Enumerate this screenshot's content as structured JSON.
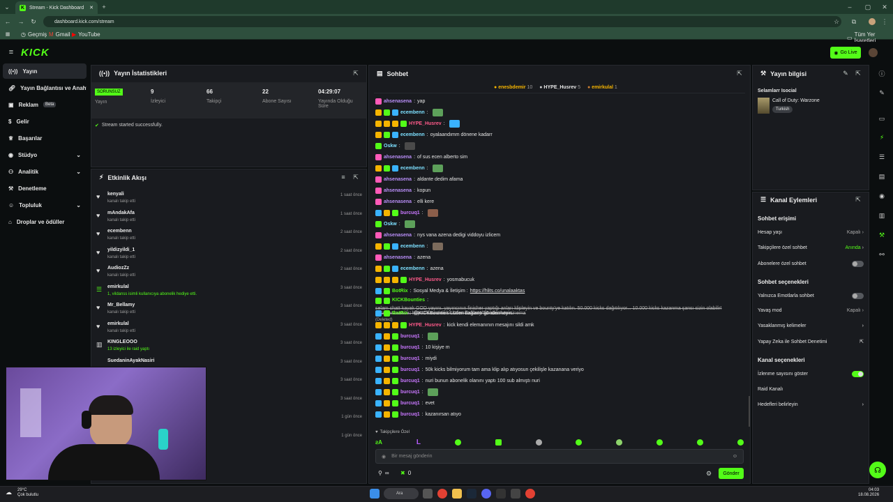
{
  "browser": {
    "tab_title": "Stream - Kick Dashboard",
    "url": "dashboard.kick.com/stream",
    "bookmarks": [
      "Geçmiş",
      "Gmail",
      "YouTube"
    ],
    "all_bookmarks": "Tüm Yer İşaretleri"
  },
  "header": {
    "logo": "KICK",
    "go_live": "Go Live"
  },
  "sidebar": {
    "items": [
      {
        "label": "Yayın"
      },
      {
        "label": "Yayın Bağlantısı ve Anahtarı"
      },
      {
        "label": "Reklam",
        "badge": "Beta"
      },
      {
        "label": "Gelir"
      },
      {
        "label": "Başarılar"
      },
      {
        "label": "Stüdyo"
      },
      {
        "label": "Analitik"
      },
      {
        "label": "Denetleme"
      },
      {
        "label": "Topluluk"
      },
      {
        "label": "Droplar ve ödüller"
      }
    ]
  },
  "stats": {
    "title": "Yayın İstatistikleri",
    "status_badge": "SORUNSUZ",
    "status_label": "Yayın",
    "viewers": "9",
    "viewers_label": "İzleyici",
    "followers": "66",
    "followers_label": "Takipçi",
    "subs": "22",
    "subs_label": "Abone Sayısı",
    "uptime": "04:29:07",
    "uptime_label": "Yayında Olduğu Süre",
    "success": "Stream started successfully."
  },
  "activity": {
    "title": "Etkinlik Akışı",
    "items": [
      {
        "name": "kenyali",
        "desc": "kanalı takip etti",
        "time": "1 saat önce"
      },
      {
        "name": "mAndakAfa",
        "desc": "kanalı takip etti",
        "time": "1 saat önce"
      },
      {
        "name": "ecembenn",
        "desc": "kanalı takip etti",
        "time": "2 saat önce"
      },
      {
        "name": "yildizyildi_1",
        "desc": "kanalı takip etti",
        "time": "2 saat önce"
      },
      {
        "name": "AudiozZz",
        "desc": "kanalı takip etti",
        "time": "2 saat önce"
      },
      {
        "name": "emirkulal",
        "desc": "1, vildanss isimli kullanıcıya abonelik hediye etti.",
        "time": "3 saat önce"
      },
      {
        "name": "Mr_Bellamy",
        "desc": "kanalı takip etti",
        "time": "3 saat önce"
      },
      {
        "name": "emirkulal",
        "desc": "kanalı takip etti",
        "time": "3 saat önce"
      },
      {
        "name": "KINGLEOOO",
        "desc": "13 izleyici ile raid yaptı",
        "time": "3 saat önce"
      },
      {
        "name": "SuedaninAyakNasiri",
        "desc": "",
        "time": "3 saat önce"
      },
      {
        "name": "",
        "desc": "",
        "time": "3 saat önce"
      },
      {
        "name": "",
        "desc": "",
        "time": "3 saat önce"
      },
      {
        "name": "",
        "desc": "",
        "time": "1 gün önce"
      },
      {
        "name": "",
        "desc": "",
        "time": "1 gün önce"
      }
    ]
  },
  "chat": {
    "title": "Sohbet",
    "leaders": [
      {
        "name": "enesbdemir",
        "count": "10"
      },
      {
        "name": "HYPE_Husrev",
        "count": "5"
      },
      {
        "name": "emirkulal",
        "count": "1"
      }
    ],
    "messages": [
      {
        "user": "ahsenasena",
        "color": "#b98ef8",
        "text": "yap"
      },
      {
        "user": "ecembenn",
        "color": "#7ee0ff",
        "text": ""
      },
      {
        "user": "HYPE_Husrev",
        "color": "#ff5a8a",
        "text": ""
      },
      {
        "user": "ecembenn",
        "color": "#7ee0ff",
        "text": "oyalaandımm dönene kadarr"
      },
      {
        "user": "Oskw",
        "color": "#7ee0ff",
        "text": ""
      },
      {
        "user": "ahsenasena",
        "color": "#b98ef8",
        "text": "of sus ecen alberto sim"
      },
      {
        "user": "ecembenn",
        "color": "#7ee0ff",
        "text": ""
      },
      {
        "user": "ahsenasena",
        "color": "#b98ef8",
        "text": "aldante dedim afama"
      },
      {
        "user": "ahsenasena",
        "color": "#b98ef8",
        "text": "kopun"
      },
      {
        "user": "ahsenasena",
        "color": "#b98ef8",
        "text": "elli kere"
      },
      {
        "user": "burcuq1",
        "color": "#c977ff",
        "text": ""
      },
      {
        "user": "Oskw",
        "color": "#7ee0ff",
        "text": ""
      },
      {
        "user": "ahsenasena",
        "color": "#b98ef8",
        "text": "nys vana azena dedigi viddoyu izlicem"
      },
      {
        "user": "ecembenn",
        "color": "#7ee0ff",
        "text": ""
      },
      {
        "user": "ahsenasena",
        "color": "#b98ef8",
        "text": "azena"
      },
      {
        "user": "ecembenn",
        "color": "#7ee0ff",
        "text": "azena"
      },
      {
        "user": "HYPE_Husrev",
        "color": "#ff5a8a",
        "text": "yosmabucuk"
      },
      {
        "user": "BotRix",
        "color": "#53fc18",
        "text": "Sosyal Medya & İletişim : ",
        "link": "https://hlits.co/unalaaktas"
      },
      {
        "user": "KICKBounties",
        "color": "#53fc18",
        "text": "selam chatt kayak GOD yayını. yayıncının finisher yaptığı anları klipleyin ve bounty'ye katılın. 50.000 kicks dağıtılıyor... 10.000 kicks kazanma şansı sizin olabilir! detaylar burada: https://bounties.kick.com/bounty/58-absolute-cinema",
        "deleted": "(Deleted)"
      },
      {
        "user": "BotRix",
        "color": "#53fc18",
        "text": "@KICKBounties Lütfen bağlantı göndermeyin."
      },
      {
        "user": "HYPE_Husrev",
        "color": "#ff5a8a",
        "text": "kick kendi elemanının mesajını sildi amk"
      },
      {
        "user": "burcuq1",
        "color": "#c977ff",
        "text": ""
      },
      {
        "user": "burcuq1",
        "color": "#c977ff",
        "text": "10 kişiye m"
      },
      {
        "user": "burcuq1",
        "color": "#c977ff",
        "text": "miydi"
      },
      {
        "user": "burcuq1",
        "color": "#c977ff",
        "text": "50k kicks bilmiyorum tam ama klip alıp atıyosun çekilişle kazanana veriyo"
      },
      {
        "user": "burcuq1",
        "color": "#c977ff",
        "text": "nuri bunun abonelik olanını yaptı 100 sub almıştı nuri"
      },
      {
        "user": "burcuq1",
        "color": "#c977ff",
        "text": ""
      },
      {
        "user": "burcuq1",
        "color": "#c977ff",
        "text": "evet"
      },
      {
        "user": "burcuq1",
        "color": "#c977ff",
        "text": "kazanırsan atıyo"
      }
    ],
    "followers_only": "Takipçilere Özel",
    "input_placeholder": "Bir mesaj gönderin",
    "infinity": "∞",
    "count": "0",
    "send": "Gönder"
  },
  "stream_info": {
    "title": "Yayın bilgisi",
    "stream_title": "Selamlarr Isocial",
    "category": "Call of Duty: Warzone",
    "language": "Turkish"
  },
  "channel_actions": {
    "title": "Kanal Eylemleri",
    "chat_access": "Sohbet erişimi",
    "account_age": "Hesap yaşı",
    "account_age_val": "Kapalı",
    "followers_chat": "Takipçilere özel sohbet",
    "followers_chat_val": "Anında",
    "subs_chat": "Abonelere özel sohbet",
    "chat_options": "Sohbet seçenekleri",
    "emote_only": "Yalnızca Emotlarla sohbet",
    "slow_mode": "Yavaş mod",
    "slow_mode_val": "Kapalı",
    "banned_words": "Yasaklanmış kelimeler",
    "ai_mod": "Yapay Zeka ile Sohbet Denetimi",
    "channel_options": "Kanal seçenekleri",
    "show_viewers": "İzlenme sayısını göster",
    "raid": "Raid Kanalı",
    "goals": "Hedefleri belirleyin"
  },
  "taskbar": {
    "temp": "29°C",
    "weather": "Çok bulutlu",
    "search": "Ara",
    "time": "04:03",
    "date": "18.08.2026"
  },
  "colors": {
    "accent": "#53fc18",
    "panel": "#191b1f"
  }
}
